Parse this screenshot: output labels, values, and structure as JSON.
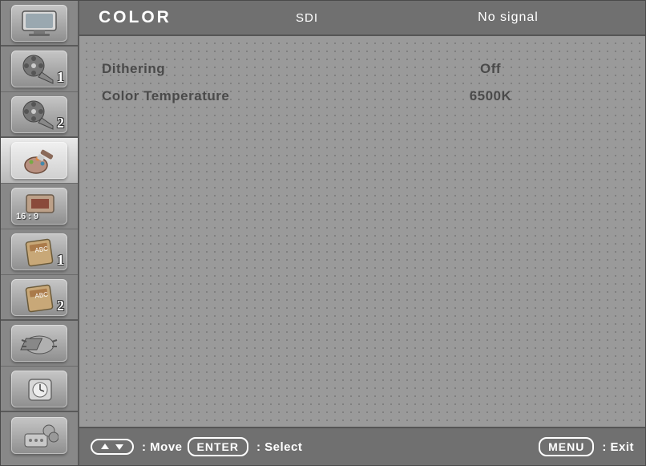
{
  "header": {
    "title": "COLOR",
    "source": "SDI",
    "signal": "No signal"
  },
  "sidebar": {
    "items": [
      {
        "name": "picture",
        "badge": ""
      },
      {
        "name": "video1",
        "badge": "1"
      },
      {
        "name": "video2",
        "badge": "2"
      },
      {
        "name": "color",
        "badge": ""
      },
      {
        "name": "aspect",
        "badge": "",
        "aspect": "16 : 9"
      },
      {
        "name": "setup1",
        "badge": "1"
      },
      {
        "name": "setup2",
        "badge": "2"
      },
      {
        "name": "system",
        "badge": ""
      },
      {
        "name": "time",
        "badge": ""
      },
      {
        "name": "remote",
        "badge": ""
      }
    ]
  },
  "settings": [
    {
      "label": "Dithering",
      "value": "Off"
    },
    {
      "label": "Color Temperature",
      "value": "6500K"
    }
  ],
  "footer": {
    "move": ": Move",
    "enter_btn": "ENTER",
    "select": ": Select",
    "menu_btn": "MENU",
    "exit": ": Exit"
  }
}
